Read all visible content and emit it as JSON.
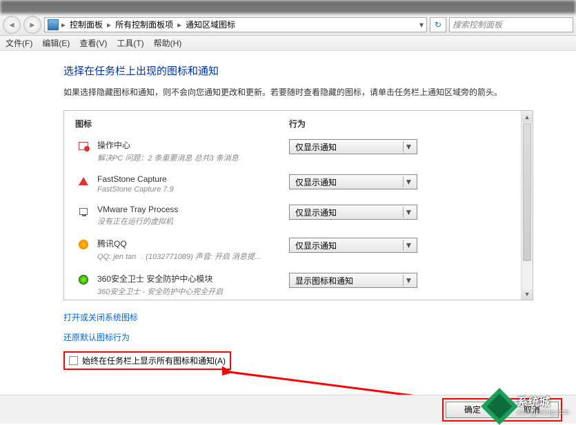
{
  "breadcrumbs": [
    "控制面板",
    "所有控制面板项",
    "通知区域图标"
  ],
  "search_placeholder": "搜索控制面板",
  "menu": {
    "file": "文件(F)",
    "edit": "编辑(E)",
    "view": "查看(V)",
    "tools": "工具(T)",
    "help": "帮助(H)"
  },
  "page_title": "选择在任务栏上出现的图标和通知",
  "page_desc": "如果选择隐藏图标和通知，则不会向您通知更改和更新。若要随时查看隐藏的图标，请单击任务栏上通知区域旁的箭头。",
  "columns": {
    "icon": "图标",
    "behavior": "行为"
  },
  "rows": [
    {
      "name": "操作中心",
      "sub": "解决PC 问题：2 条重要消息 总共3 条消息",
      "action": "仅显示通知",
      "icon": "flag"
    },
    {
      "name": "FastStone Capture",
      "sub": "FastStone Capture 7.9",
      "action": "仅显示通知",
      "icon": "fs"
    },
    {
      "name": "VMware Tray Process",
      "sub": "没有正在运行的虚拟机",
      "action": "仅显示通知",
      "icon": "vm"
    },
    {
      "name": "腾讯QQ",
      "sub": "QQ: jen tan ﹒(1032771089)  声音: 开启  消息提...",
      "action": "仅显示通知",
      "icon": "qq"
    },
    {
      "name": "360安全卫士 安全防护中心模块",
      "sub": "360安全卫士 - 安全防护中心完全开启",
      "action": "显示图标和通知",
      "icon": "360"
    }
  ],
  "links": {
    "system_icons": "打开或关闭系统图标",
    "restore_defaults": "还原默认图标行为"
  },
  "checkbox_label": "始终在任务栏上显示所有图标和通知(A)",
  "buttons": {
    "ok": "确定",
    "cancel": "取消"
  },
  "watermark": {
    "cn": "系统城",
    "en": "xitongcheng.com"
  }
}
